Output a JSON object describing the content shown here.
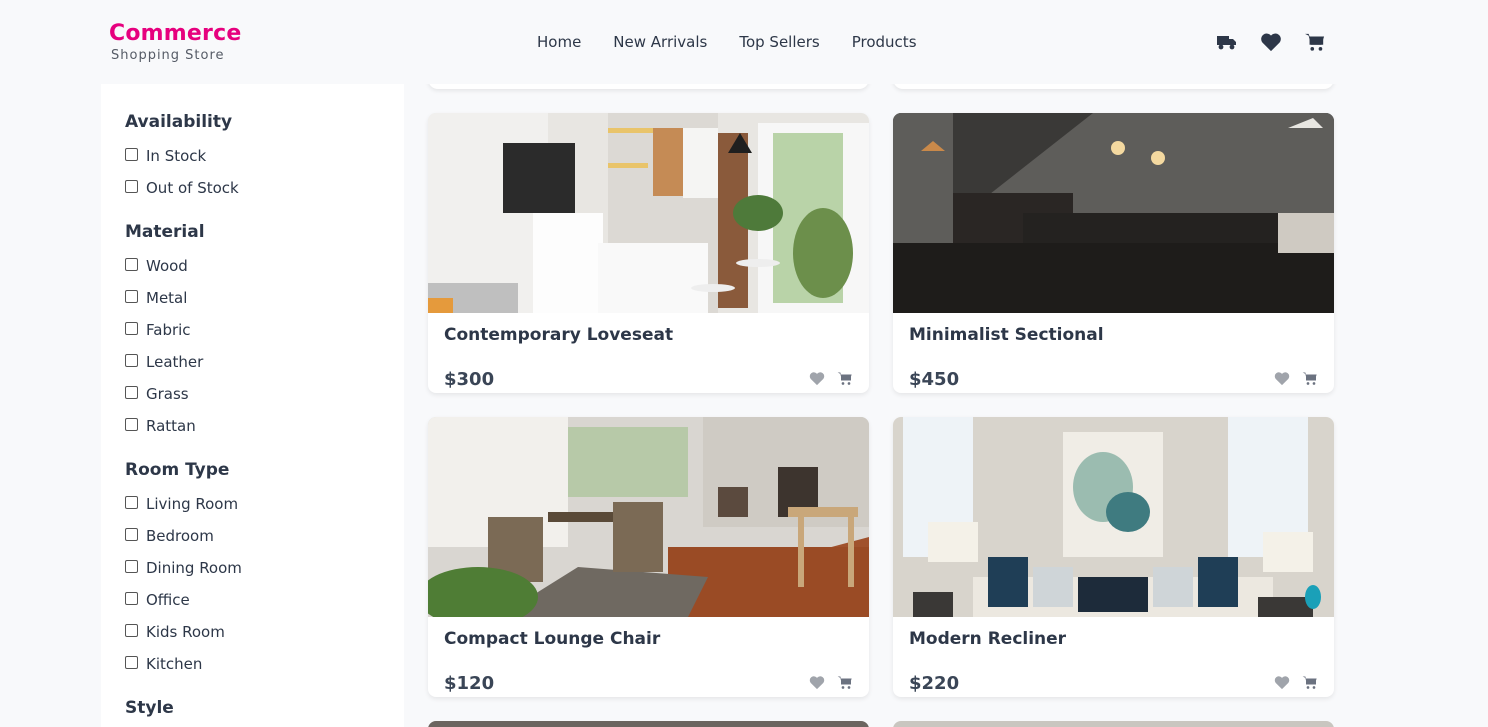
{
  "header": {
    "brand": "Commerce",
    "tagline": "Shopping Store",
    "nav": [
      "Home",
      "New Arrivals",
      "Top Sellers",
      "Products"
    ],
    "icons": [
      "truck-icon",
      "heart-icon",
      "cart-icon"
    ]
  },
  "sidebar": {
    "groups": [
      {
        "title": "Availability",
        "options": [
          "In Stock",
          "Out of Stock"
        ]
      },
      {
        "title": "Material",
        "options": [
          "Wood",
          "Metal",
          "Fabric",
          "Leather",
          "Grass",
          "Rattan"
        ]
      },
      {
        "title": "Room Type",
        "options": [
          "Living Room",
          "Bedroom",
          "Dining Room",
          "Office",
          "Kids Room",
          "Kitchen"
        ]
      },
      {
        "title": "Style",
        "options": []
      }
    ]
  },
  "products": [
    {
      "name": "Contemporary Loveseat",
      "price": "$300"
    },
    {
      "name": "Minimalist Sectional",
      "price": "$450"
    },
    {
      "name": "Compact Lounge Chair",
      "price": "$120"
    },
    {
      "name": "Modern Recliner",
      "price": "$220"
    }
  ],
  "colors": {
    "brand": "#e6007e",
    "text": "#2d3748",
    "background": "#f8f9fb"
  }
}
